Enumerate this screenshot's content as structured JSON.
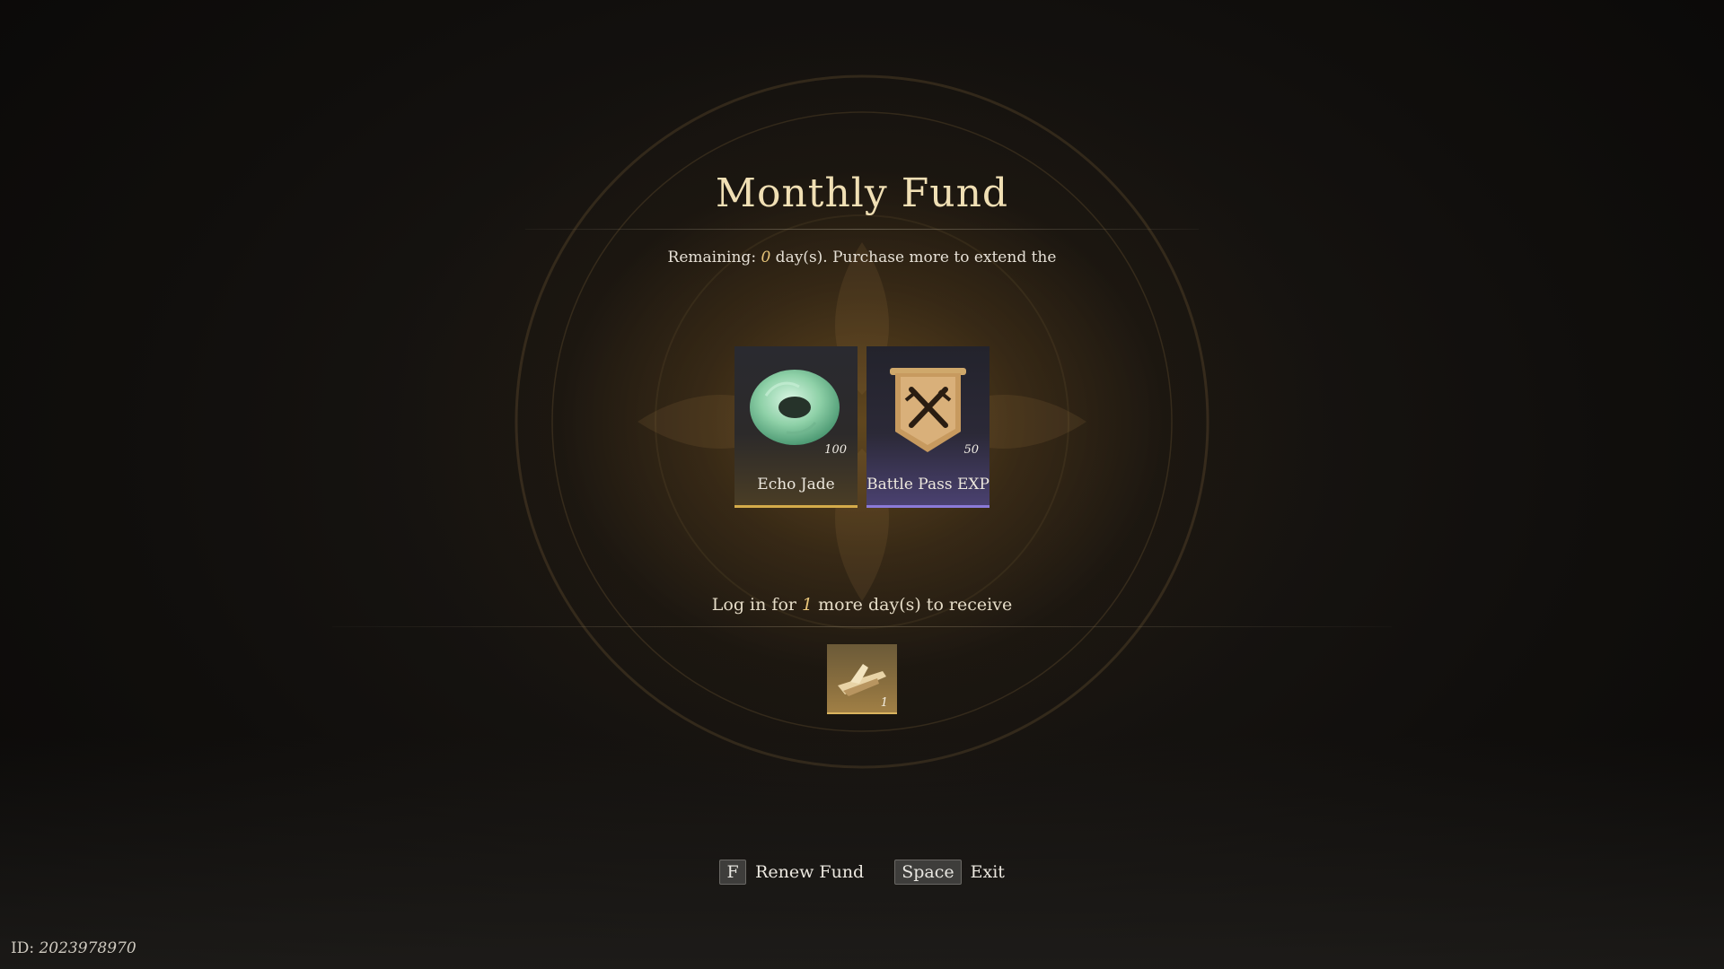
{
  "title": "Monthly Fund",
  "remaining": {
    "prefix": "Remaining: ",
    "days": "0",
    "suffix": " day(s). Purchase more to extend the"
  },
  "rewards": [
    {
      "name": "Echo Jade",
      "quantity": "100",
      "rarity_color": "#d4ab4a",
      "icon": "jade-disc-icon"
    },
    {
      "name": "Battle Pass EXP",
      "quantity": "50",
      "rarity_color": "#8b7ad8",
      "icon": "banner-crossed-swords-icon"
    }
  ],
  "login": {
    "prefix": "Log in for ",
    "days": "1",
    "suffix": " more day(s) to receive"
  },
  "bonus_reward": {
    "quantity": "1",
    "icon": "gold-ship-icon"
  },
  "prompts": [
    {
      "key": "F",
      "label": "Renew Fund"
    },
    {
      "key": "Space",
      "label": "Exit"
    }
  ],
  "uid": {
    "label": "ID: ",
    "value": "2023978970"
  }
}
